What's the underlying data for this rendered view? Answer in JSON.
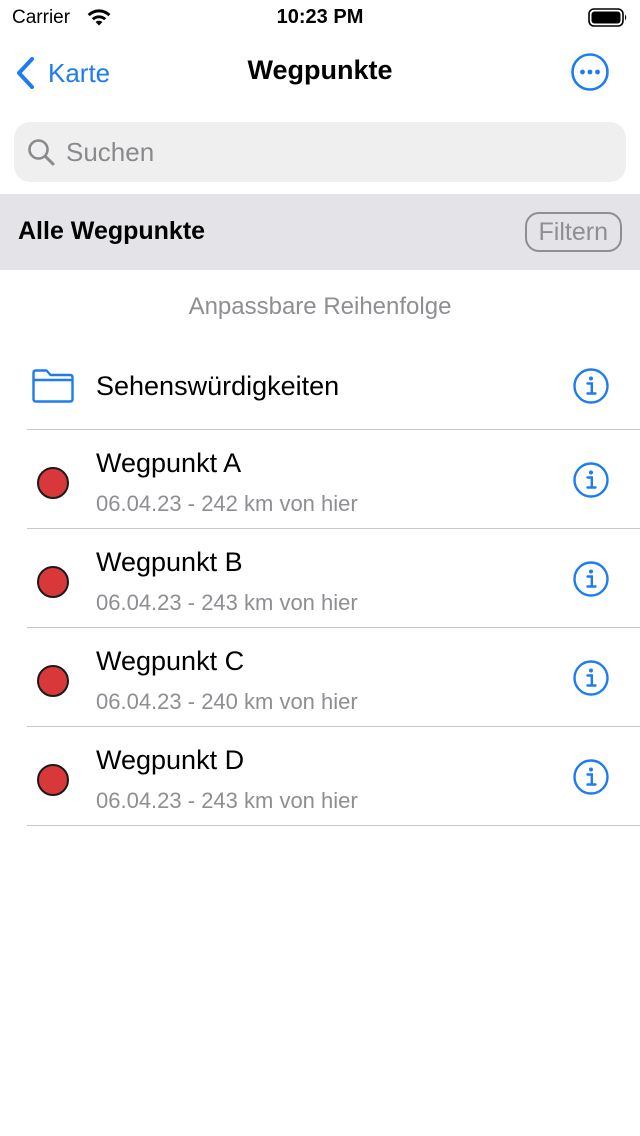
{
  "status_bar": {
    "carrier": "Carrier",
    "time": "10:23 PM"
  },
  "nav": {
    "back_label": "Karte",
    "title": "Wegpunkte",
    "more_icon": "ellipsis-circle-icon"
  },
  "search": {
    "placeholder": "Suchen",
    "value": ""
  },
  "section": {
    "title": "Alle Wegpunkte",
    "filter_label": "Filtern"
  },
  "sort_hint": "Anpassbare Reihenfolge",
  "folders": [
    {
      "label": "Sehenswürdigkeiten",
      "icon": "folder-icon"
    }
  ],
  "waypoints": [
    {
      "title": "Wegpunkt A",
      "subtitle": "06.04.23 - 242 km von hier"
    },
    {
      "title": "Wegpunkt B",
      "subtitle": "06.04.23 - 243 km von hier"
    },
    {
      "title": "Wegpunkt C",
      "subtitle": "06.04.23 - 240 km von hier"
    },
    {
      "title": "Wegpunkt D",
      "subtitle": "06.04.23 - 243 km von hier"
    }
  ],
  "colors": {
    "accent": "#1d7cf2",
    "waypoint_dot": "#d9383a",
    "secondary_text": "#8e8e93",
    "section_background": "#e4e4e8",
    "search_background": "#efeff0"
  }
}
